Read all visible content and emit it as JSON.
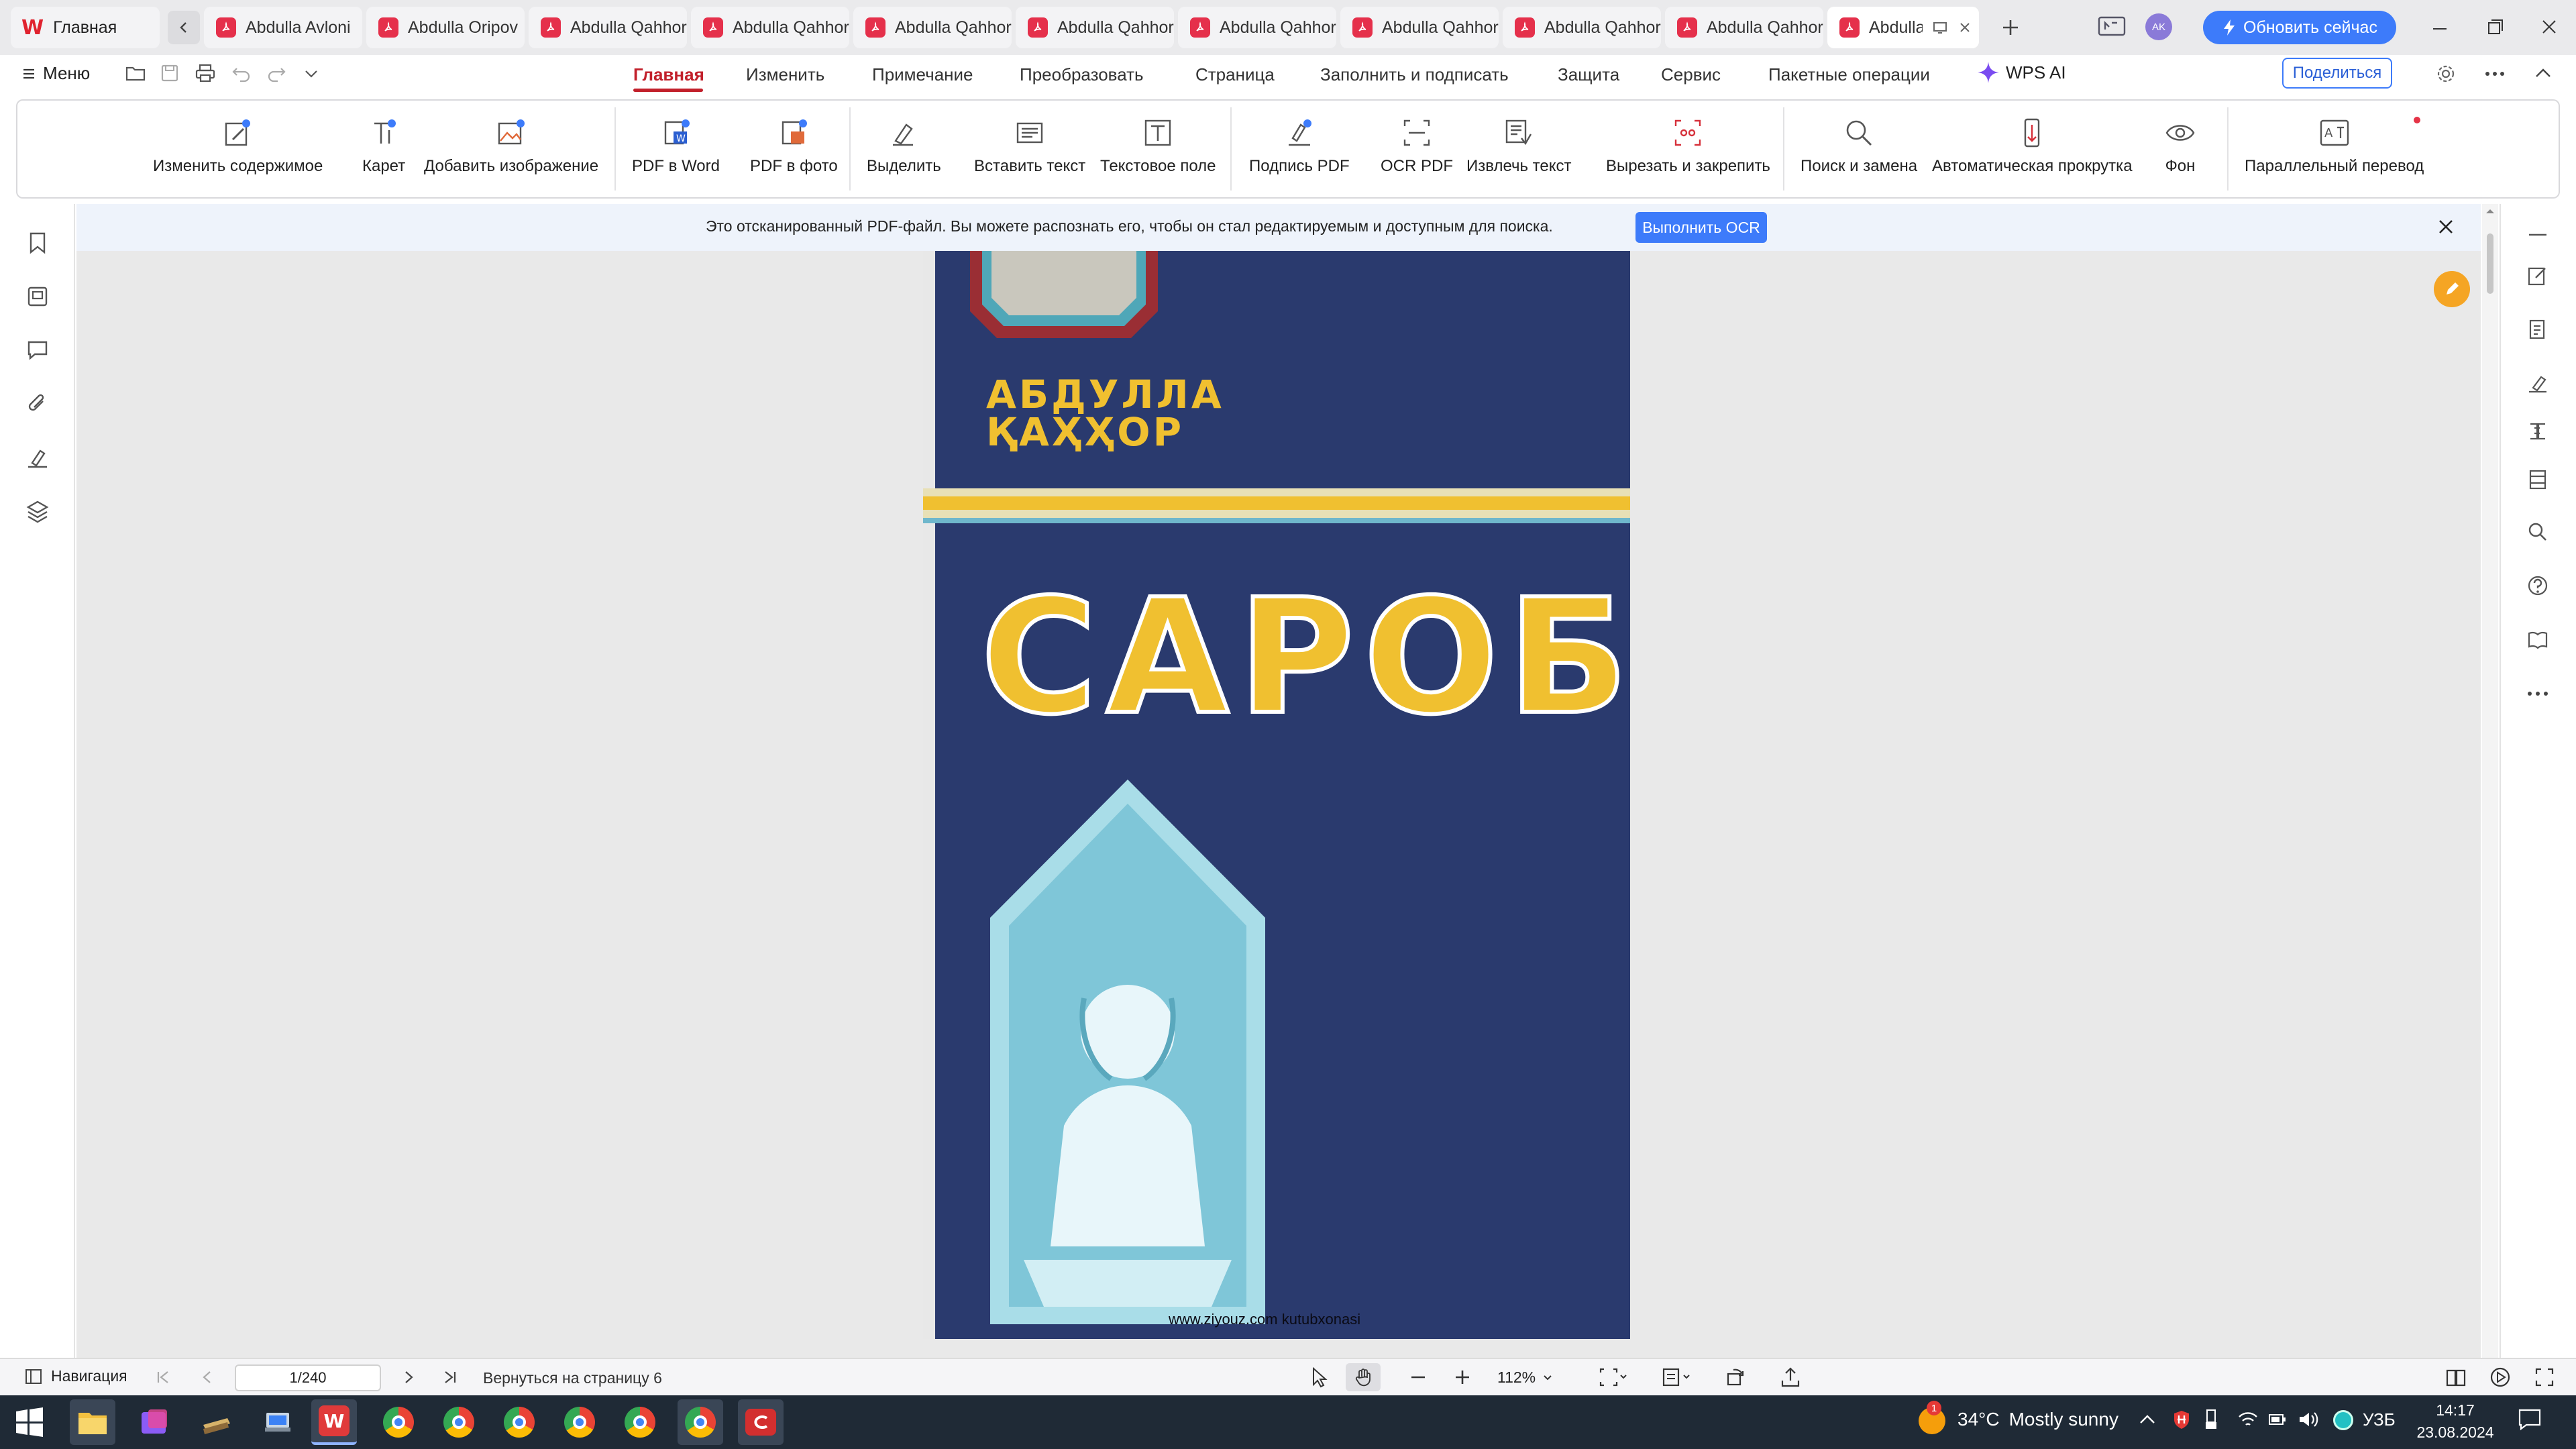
{
  "tabs": {
    "home": "Главная",
    "docs": [
      "Abdulla Avloni",
      "Abdulla Oripov",
      "Abdulla Qahhor",
      "Abdulla Qahhor",
      "Abdulla Qahhor",
      "Abdulla Qahhor",
      "Abdulla Qahhor",
      "Abdulla Qahhor",
      "Abdulla Qahhor",
      "Abdulla Qahhor",
      "Abdulla Qahhor"
    ],
    "update_button": "Обновить сейчас",
    "avatar": "AK"
  },
  "menu": {
    "menu_label": "Меню",
    "items": [
      "Главная",
      "Изменить",
      "Примечание",
      "Преобразовать",
      "Страница",
      "Заполнить и подписать",
      "Защита",
      "Сервис",
      "Пакетные операции",
      "WPS AI"
    ],
    "share_button": "Поделиться"
  },
  "ribbon": {
    "buttons": [
      "Изменить содержимое",
      "Карет",
      "Добавить изображение",
      "PDF в Word",
      "PDF в фото",
      "Выделить",
      "Вставить текст",
      "Текстовое поле",
      "Подпись PDF",
      "OCR PDF",
      "Извлечь текст",
      "Вырезать и закрепить",
      "Поиск и замена",
      "Автоматическая прокрутка",
      "Фон",
      "Параллельный перевод"
    ]
  },
  "ocr_banner": {
    "message": "Это отсканированный PDF-файл. Вы можете распознать его, чтобы он стал редактируемым и доступным для поиска.",
    "button": "Выполнить OCR"
  },
  "document": {
    "author_line1": "АБДУЛЛА",
    "author_line2": "ҚАҲҲОР",
    "title": "САРОБ",
    "watermark": "www.ziyouz.com kutubxonasi"
  },
  "statusbar": {
    "navigation": "Навигация",
    "page_indicator": "1/240",
    "back_to_page": "Вернуться на страницу 6",
    "zoom": "112%"
  },
  "taskbar": {
    "temperature": "34°C",
    "weather": "Mostly sunny",
    "language": "УЗБ",
    "time": "14:17",
    "date": "23.08.2024",
    "weather_badge": "1"
  },
  "colors": {
    "accent_red": "#c2202b",
    "update_button": "#3d7bfa",
    "book_cover": "#2a3a6e",
    "title_yellow": "#f0c030"
  }
}
